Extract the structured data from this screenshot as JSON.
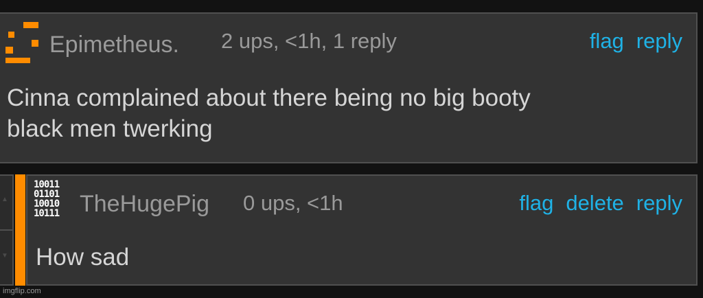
{
  "comments": [
    {
      "username": "Epimetheus.",
      "meta": "2 ups, <1h, 1 reply",
      "actions": [
        "flag",
        "reply"
      ],
      "body_lines": [
        "Cinna complained about there being no big booty",
        "black men twerking"
      ]
    },
    {
      "username": "TheHugePig",
      "avatar_bits": "10011\n01101\n10010\n10111",
      "meta": "0 ups, <1h",
      "actions": [
        "flag",
        "delete",
        "reply"
      ],
      "body": "How sad"
    }
  ],
  "watermark": "imgflip.com",
  "colors": {
    "background": "#121212",
    "panel": "#333333",
    "link": "#1fb2e6",
    "accent": "#ff8c00",
    "muted_text": "#9a9a9a",
    "body_text": "#d6d6d6"
  },
  "icons": [
    "upvote-arrow-icon",
    "downvote-arrow-icon"
  ]
}
